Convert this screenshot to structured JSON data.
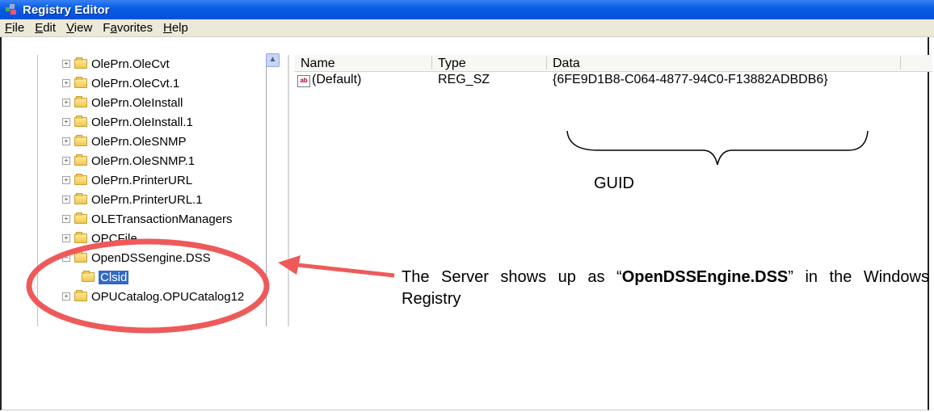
{
  "window": {
    "title": "Registry Editor"
  },
  "menu": [
    {
      "label": "File",
      "key": "F",
      "rest": "ile"
    },
    {
      "label": "Edit",
      "key": "E",
      "rest": "dit"
    },
    {
      "label": "View",
      "key": "V",
      "rest": "iew"
    },
    {
      "label": "Favorites",
      "pre": "F",
      "key": "a",
      "rest": "vorites"
    },
    {
      "label": "Help",
      "key": "H",
      "rest": "elp"
    }
  ],
  "tree": {
    "items": [
      {
        "label": "OlePrn.OleCvt"
      },
      {
        "label": "OlePrn.OleCvt.1"
      },
      {
        "label": "OlePrn.OleInstall"
      },
      {
        "label": "OlePrn.OleInstall.1"
      },
      {
        "label": "OlePrn.OleSNMP"
      },
      {
        "label": "OlePrn.OleSNMP.1"
      },
      {
        "label": "OlePrn.PrinterURL"
      },
      {
        "label": "OlePrn.PrinterURL.1"
      },
      {
        "label": "OLETransactionManagers"
      },
      {
        "label": "OPCFile"
      },
      {
        "label": "OpenDSSengine.DSS"
      },
      {
        "label": "Clsid"
      },
      {
        "label": "OPUCatalog.OPUCatalog12"
      }
    ]
  },
  "list": {
    "columns": [
      "Name",
      "Type",
      "Data"
    ],
    "rows": [
      {
        "name": "(Default)",
        "type": "REG_SZ",
        "data": "{6FE9D1B8-C064-4877-94C0-F13882ADBDB6}"
      }
    ]
  },
  "annotations": {
    "guid_label": "GUID",
    "server_text_pre": "The Server shows up as “",
    "server_text_bold": "OpenDSSEngine.DSS",
    "server_text_post": "” in the Windows Registry",
    "highlight_color": "#ee5a5a"
  }
}
